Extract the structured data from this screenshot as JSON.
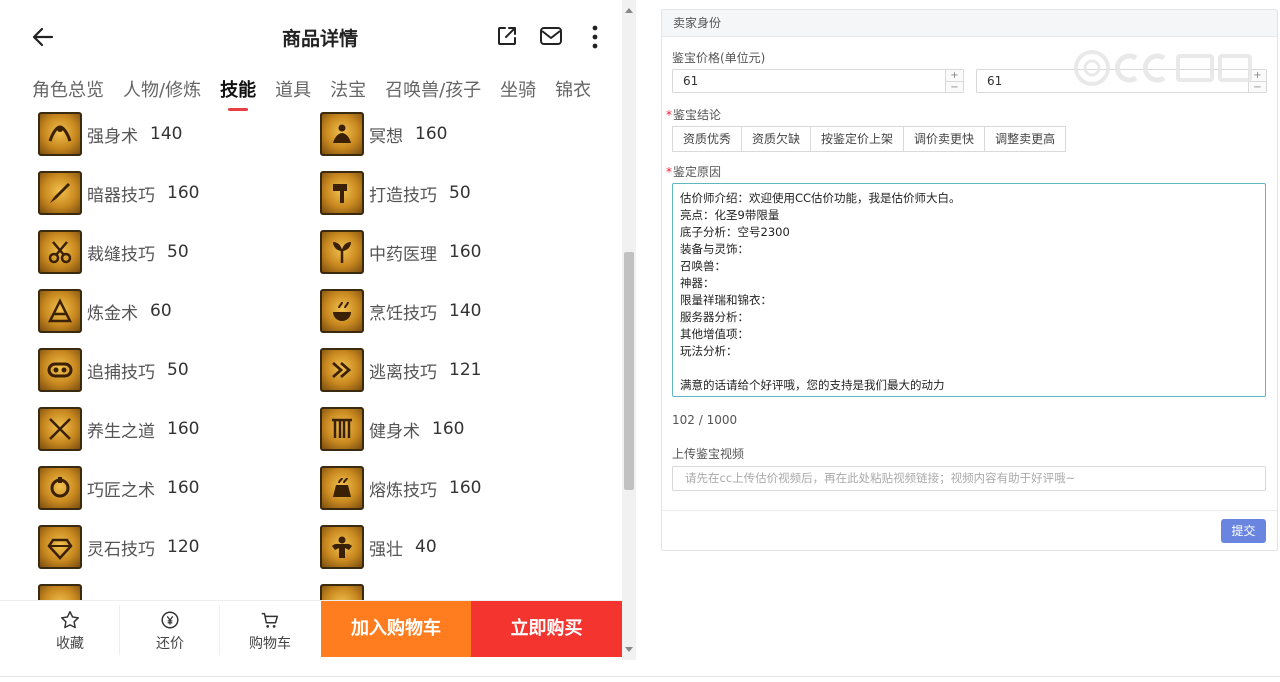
{
  "header": {
    "title": "商品详情"
  },
  "tabs": [
    {
      "label": "角色总览",
      "active": false
    },
    {
      "label": "人物/修炼",
      "active": false
    },
    {
      "label": "技能",
      "active": true
    },
    {
      "label": "道具",
      "active": false
    },
    {
      "label": "法宝",
      "active": false
    },
    {
      "label": "召唤兽/孩子",
      "active": false
    },
    {
      "label": "坐骑",
      "active": false
    },
    {
      "label": "锦衣",
      "active": false
    }
  ],
  "skills": [
    {
      "name": "强身术",
      "level": "140",
      "icon": "strength-icon"
    },
    {
      "name": "冥想",
      "level": "160",
      "icon": "meditation-icon"
    },
    {
      "name": "暗器技巧",
      "level": "160",
      "icon": "dart-icon"
    },
    {
      "name": "打造技巧",
      "level": "50",
      "icon": "hammer-icon"
    },
    {
      "name": "裁缝技巧",
      "level": "50",
      "icon": "scissors-icon"
    },
    {
      "name": "中药医理",
      "level": "160",
      "icon": "herb-icon"
    },
    {
      "name": "炼金术",
      "level": "60",
      "icon": "alchemy-icon"
    },
    {
      "name": "烹饪技巧",
      "level": "140",
      "icon": "cooking-icon"
    },
    {
      "name": "追捕技巧",
      "level": "50",
      "icon": "shackle-icon"
    },
    {
      "name": "逃离技巧",
      "level": "121",
      "icon": "escape-icon"
    },
    {
      "name": "养生之道",
      "level": "160",
      "icon": "health-icon"
    },
    {
      "name": "健身术",
      "level": "160",
      "icon": "fitness-icon"
    },
    {
      "name": "巧匠之术",
      "level": "160",
      "icon": "craftsman-icon"
    },
    {
      "name": "熔炼技巧",
      "level": "160",
      "icon": "smelting-icon"
    },
    {
      "name": "灵石技巧",
      "level": "120",
      "icon": "gem-icon"
    },
    {
      "name": "强壮",
      "level": "40",
      "icon": "muscle-icon"
    }
  ],
  "bottom_bar": {
    "favorite_label": "收藏",
    "bargain_label": "还价",
    "cart_label": "购物车",
    "add_cart_label": "加入购物车",
    "buy_now_label": "立即购买"
  },
  "form": {
    "section_title": "卖家身份",
    "price_label": "鉴宝价格(单位元)",
    "price_min": "61",
    "price_max": "61",
    "conclusion_label": "鉴宝结论",
    "conclusion_options": [
      "资质优秀",
      "资质欠缺",
      "按鉴定价上架",
      "调价卖更快",
      "调整卖更高"
    ],
    "reason_label": "鉴定原因",
    "reason_lines": [
      "估价师介绍：欢迎使用CC估价功能，我是估价师大白。",
      "亮点：化圣9带限量",
      "底子分析：空号2300",
      "装备与灵饰：",
      "召唤兽：",
      "神器：",
      "限量祥瑞和锦衣：",
      "服务器分析：",
      "其他增值项：",
      "玩法分析：",
      "",
      "满意的话请给个好评哦，您的支持是我们最大的动力"
    ],
    "char_count": "102 / 1000",
    "video_label": "上传鉴宝视频",
    "video_placeholder": "请先在cc上传估价视频后，再在此处粘贴视频链接；视频内容有助于好评哦~",
    "submit_label": "提交"
  },
  "colors": {
    "accent_red": "#f4342f",
    "accent_orange": "#ff7d1e",
    "tab_underline": "#e84040",
    "submit_blue": "#6a85e0",
    "textarea_border": "#5fb7c0"
  }
}
